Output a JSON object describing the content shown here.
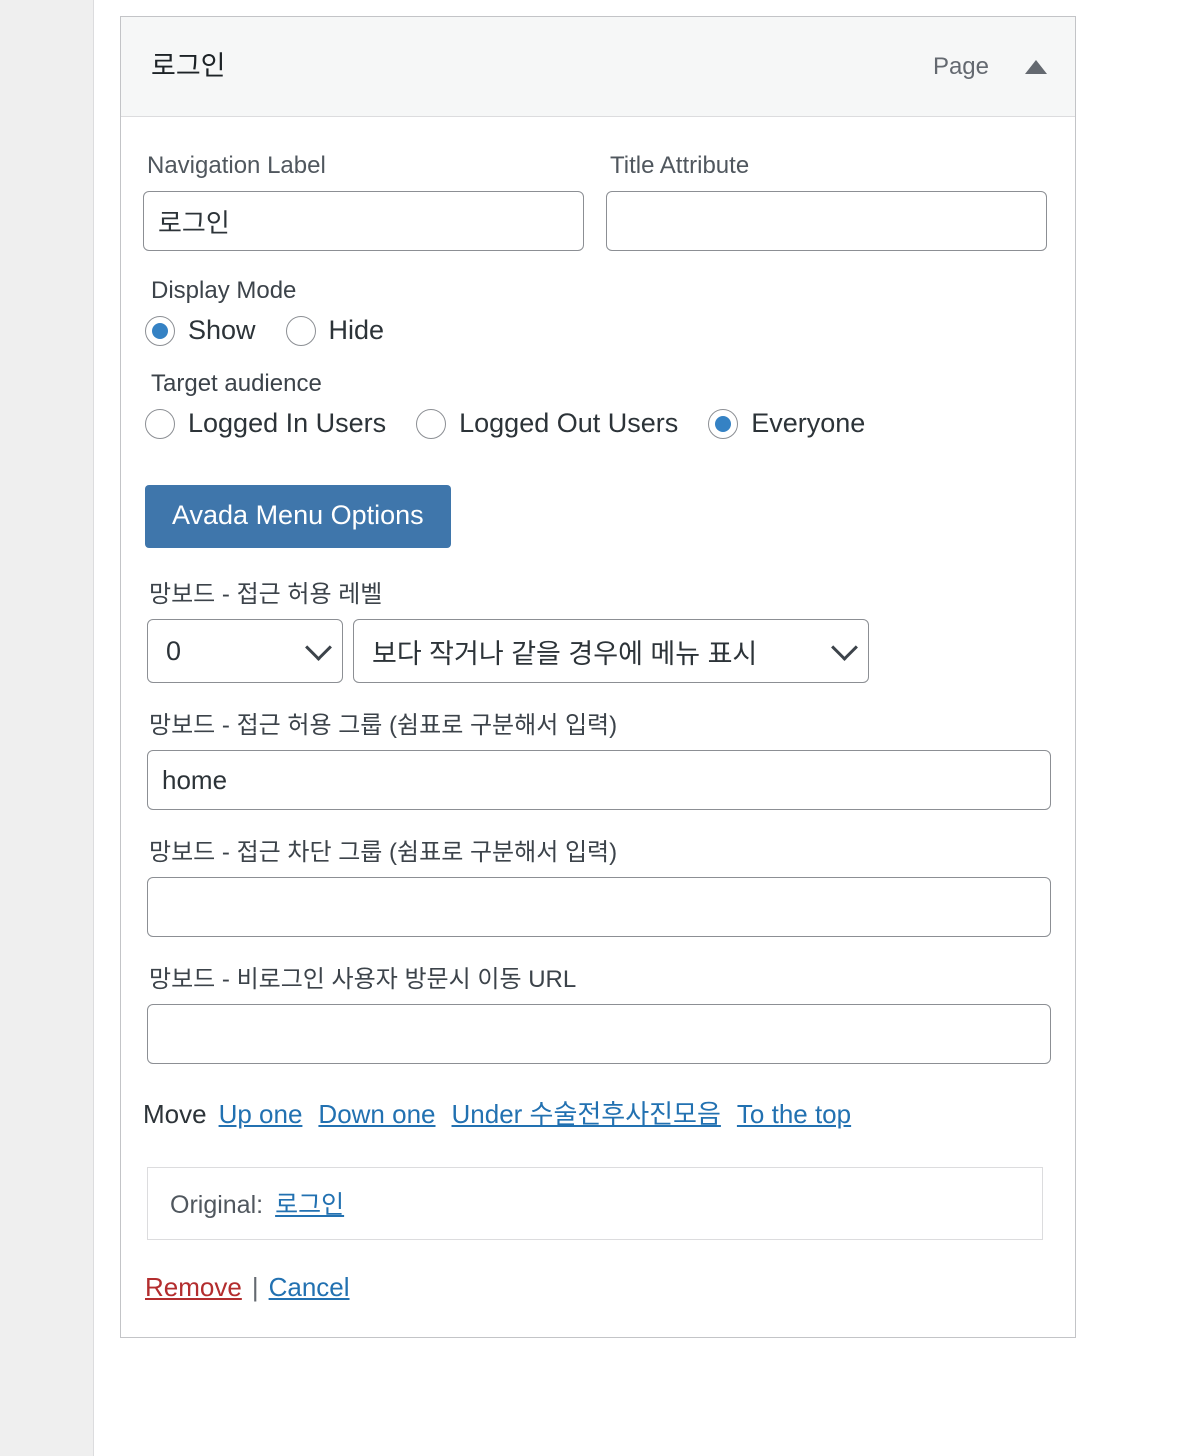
{
  "panel": {
    "title": "로그인",
    "item_type": "Page",
    "toggle_icon": "triangle-up-icon"
  },
  "fields": {
    "navigation_label": {
      "label": "Navigation Label",
      "value": "로그인",
      "placeholder": ""
    },
    "title_attribute": {
      "label": "Title Attribute",
      "value": "",
      "placeholder": ""
    }
  },
  "display_mode": {
    "legend": "Display Mode",
    "options": [
      {
        "label": "Show",
        "checked": true
      },
      {
        "label": "Hide",
        "checked": false
      }
    ]
  },
  "target_audience": {
    "legend": "Target audience",
    "options": [
      {
        "label": "Logged In Users",
        "checked": false
      },
      {
        "label": "Logged Out Users",
        "checked": false
      },
      {
        "label": "Everyone",
        "checked": true
      }
    ]
  },
  "avada_button": {
    "label": "Avada Menu Options"
  },
  "access_level": {
    "label": "망보드 - 접근 허용 레벨",
    "level_value": "0",
    "rule_value": "보다 작거나 같을 경우에 메뉴 표시"
  },
  "allow_group": {
    "label": "망보드 - 접근 허용 그룹 (쉼표로 구분해서 입력)",
    "value": "home",
    "placeholder": ""
  },
  "block_group": {
    "label": "망보드 - 접근 차단 그룹 (쉼표로 구분해서 입력)",
    "value": "",
    "placeholder": ""
  },
  "redirect_url": {
    "label": "망보드 - 비로그인 사용자 방문시 이동 URL",
    "value": "",
    "placeholder": ""
  },
  "move": {
    "label": "Move",
    "links": [
      "Up one",
      "Down one",
      "Under 수술전후사진모음",
      "To the top"
    ]
  },
  "original": {
    "label": "Original:",
    "link": "로그인"
  },
  "actions": {
    "remove": "Remove",
    "separator": "|",
    "cancel": "Cancel"
  },
  "colors": {
    "accent_blue": "#3582c4",
    "button_blue": "#3f76ab",
    "link_blue": "#2271b1",
    "danger_red": "#b32d2e",
    "header_bg": "#f6f7f7",
    "panel_border": "#c3c4c7",
    "gutter_bg": "#efefef"
  }
}
